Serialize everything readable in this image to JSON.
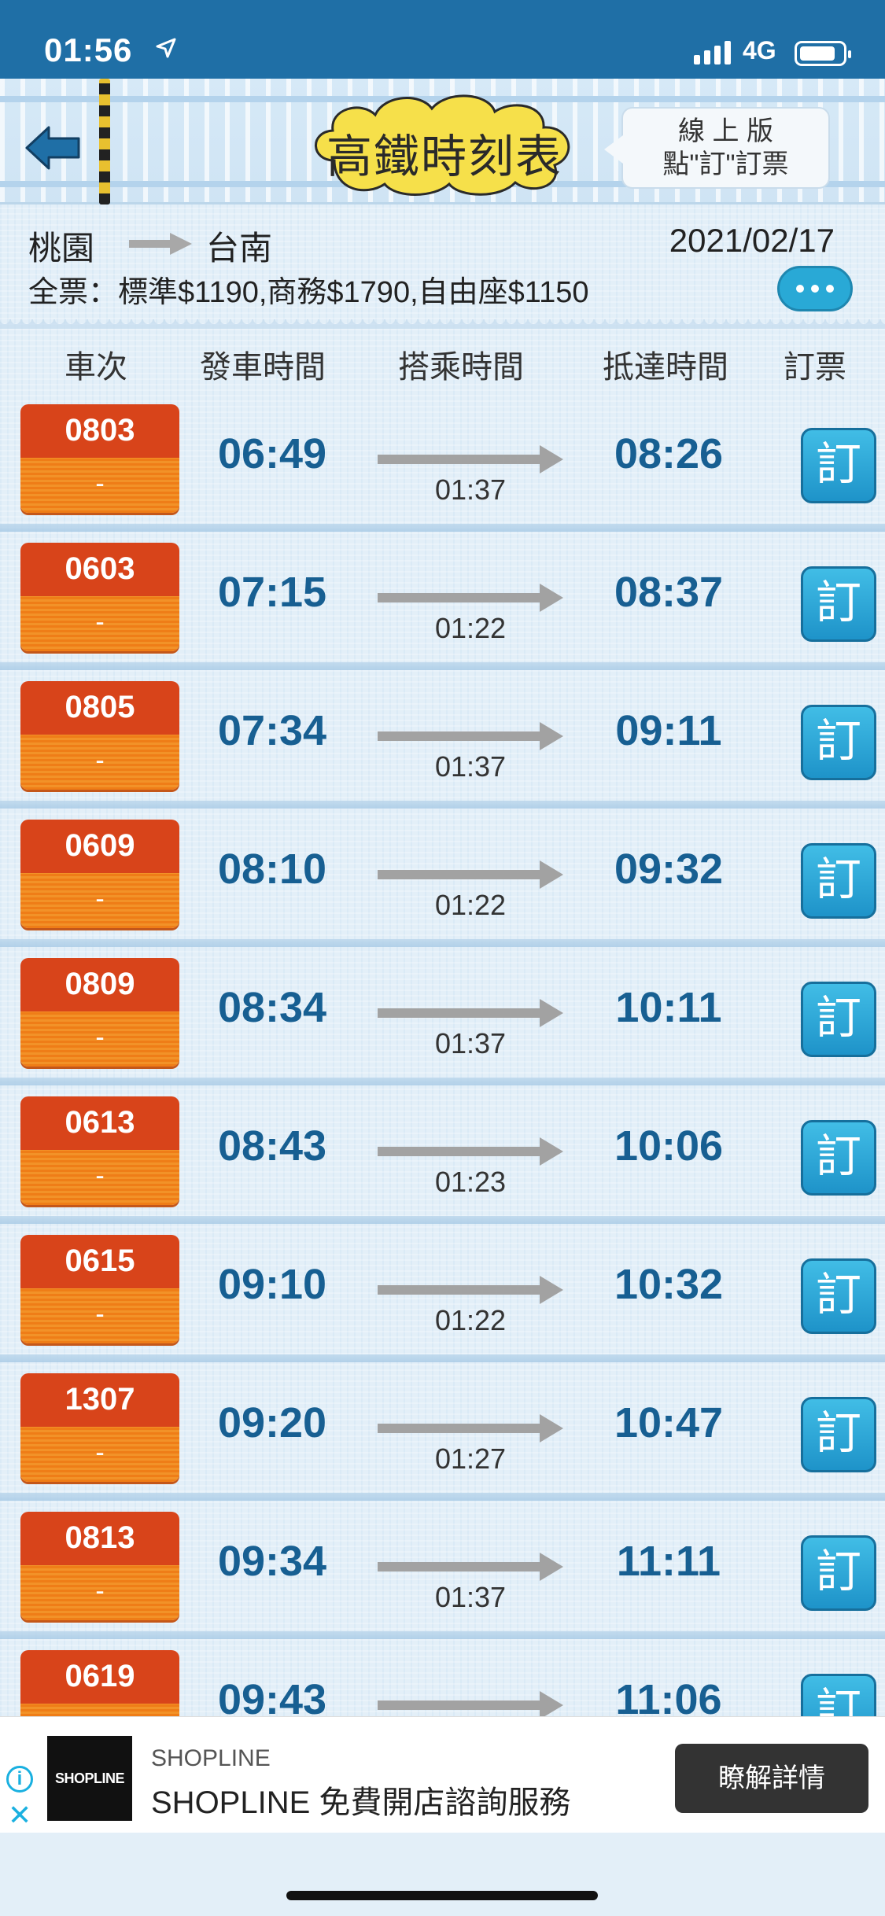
{
  "status_bar": {
    "time": "01:56",
    "network": "4G",
    "icons": [
      "location-arrow-icon",
      "signal-icon",
      "battery-icon"
    ]
  },
  "header": {
    "title": "高鐵時刻表",
    "online_line1": "線 上 版",
    "online_line2": "點\"訂\"訂票",
    "icons": [
      "back-arrow-icon"
    ]
  },
  "route": {
    "from": "桃園",
    "to": "台南",
    "date": "2021/02/17",
    "fare": "全票：標準$1190,商務$1790,自由座$1150"
  },
  "table": {
    "headers": [
      "車次",
      "發車時間",
      "搭乘時間",
      "抵達時間",
      "訂票"
    ],
    "rows": [
      {
        "train": "0803",
        "note": "-",
        "dep": "06:49",
        "dur": "01:37",
        "arr": "08:26",
        "book": "訂"
      },
      {
        "train": "0603",
        "note": "-",
        "dep": "07:15",
        "dur": "01:22",
        "arr": "08:37",
        "book": "訂"
      },
      {
        "train": "0805",
        "note": "-",
        "dep": "07:34",
        "dur": "01:37",
        "arr": "09:11",
        "book": "訂"
      },
      {
        "train": "0609",
        "note": "-",
        "dep": "08:10",
        "dur": "01:22",
        "arr": "09:32",
        "book": "訂"
      },
      {
        "train": "0809",
        "note": "-",
        "dep": "08:34",
        "dur": "01:37",
        "arr": "10:11",
        "book": "訂"
      },
      {
        "train": "0613",
        "note": "-",
        "dep": "08:43",
        "dur": "01:23",
        "arr": "10:06",
        "book": "訂"
      },
      {
        "train": "0615",
        "note": "-",
        "dep": "09:10",
        "dur": "01:22",
        "arr": "10:32",
        "book": "訂"
      },
      {
        "train": "1307",
        "note": "-",
        "dep": "09:20",
        "dur": "01:27",
        "arr": "10:47",
        "book": "訂"
      },
      {
        "train": "0813",
        "note": "-",
        "dep": "09:34",
        "dur": "01:37",
        "arr": "11:11",
        "book": "訂"
      },
      {
        "train": "0619",
        "note": "-",
        "dep": "09:43",
        "dur": "",
        "arr": "11:06",
        "book": "訂"
      }
    ]
  },
  "ad": {
    "logo": "SHOPLINE",
    "brand": "SHOPLINE",
    "description": "SHOPLINE 免費開店諮詢服務",
    "cta": "瞭解詳情",
    "info": "i",
    "close": "✕"
  },
  "colors": {
    "status_bar": "#1f6fa6",
    "train_badge_top": "#d8441a",
    "train_badge_bottom": "#ef7d17",
    "time_text": "#175f92",
    "book_button": "#29a9d6"
  }
}
